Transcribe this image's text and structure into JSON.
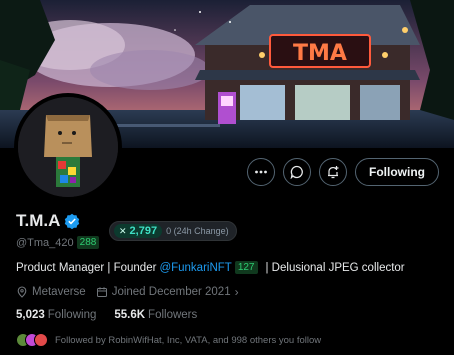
{
  "banner": {
    "sign_text": "TMA",
    "description": "Night scene of a Japanese-style shop with red neon sign"
  },
  "profile": {
    "name": "T.M.A",
    "handle": "@Tma_420",
    "handle_chip": "288",
    "verified": true
  },
  "stat_pill": {
    "value": "2,797",
    "change": "0 (24h Change)"
  },
  "actions": {
    "more_label": "More",
    "message_label": "Message",
    "notify_label": "Notifications",
    "follow_label": "Following"
  },
  "bio": {
    "part1": "Product Manager | Founder",
    "link": "@FunkariNFT",
    "link_chip": "127",
    "part2": "| Delusional JPEG collector"
  },
  "meta": {
    "location": "Metaverse",
    "joined": "Joined December 2021"
  },
  "counts": {
    "following_value": "5,023",
    "following_label": "Following",
    "followers_value": "55.6K",
    "followers_label": "Followers"
  },
  "followed_by": {
    "text": "Followed by RobinWifHat, Inc, VATA, and 998 others you follow"
  },
  "colors": {
    "accent": "#1d9bf0",
    "background": "#000000",
    "muted": "#71767b"
  }
}
